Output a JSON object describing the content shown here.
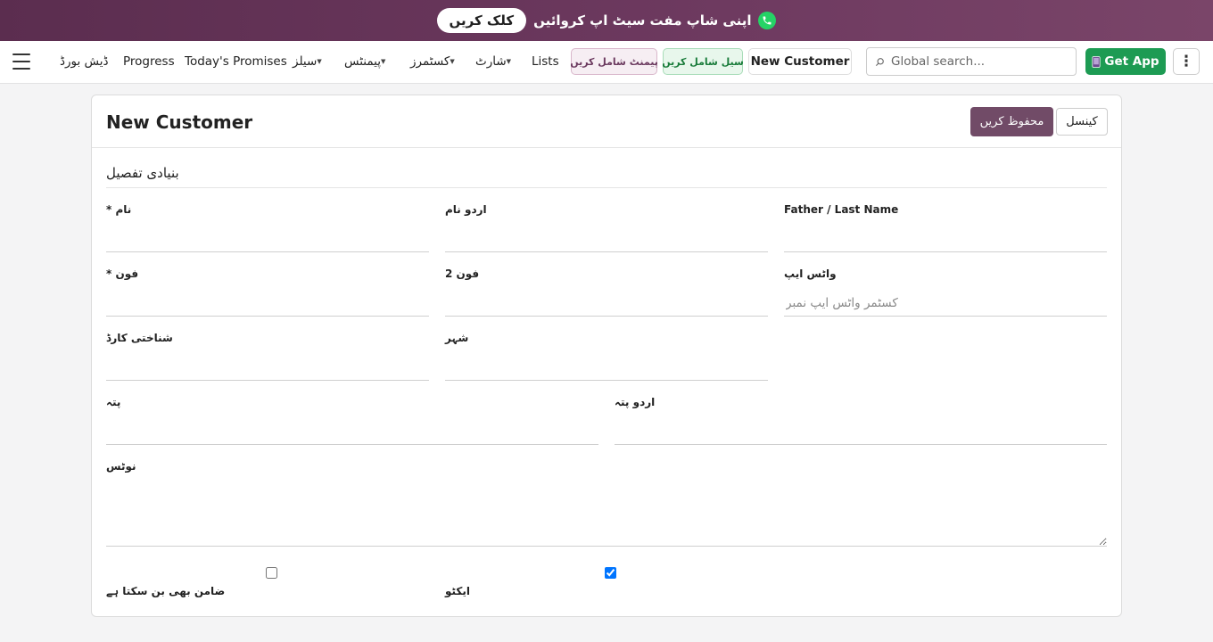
{
  "banner": {
    "text": "اپنی شاپ مفت سیٹ اپ کروائیں",
    "cta": "کلک کریں",
    "icon": "whatsapp-icon"
  },
  "nav": {
    "dashboard": "ڈیش بورڈ",
    "progress": "Progress",
    "todays_promises": "Today's Promises",
    "sales": "سیلز",
    "payments": "پیمنٹس",
    "customers": "کسٹمرز",
    "charts": "شارٹ",
    "lists": "Lists",
    "add_payment": "پیمنٹ شامل کریں",
    "add_sale": "سیل شامل کریں",
    "new_customer": "New Customer",
    "search_placeholder": "Global search...",
    "get_app": "Get App"
  },
  "form": {
    "title": "New Customer",
    "save": "محفوظ کریں",
    "cancel": "کینسل",
    "section": "بنیادی تفصیل",
    "fields": {
      "name": "* نام",
      "urdu_name": "اردو نام",
      "father_last_name": "Father / Last Name",
      "phone": "* فون",
      "phone2": "فون 2",
      "whatsapp": "واٹس ایپ",
      "whatsapp_placeholder": "کسٹمر واٹس ایپ نمبر",
      "id_card": "شناختی کارڈ",
      "city": "شہر",
      "address": "پتہ",
      "urdu_address": "اردو پتہ",
      "notes": "نوٹس",
      "guarantor": "ضامن بھی بن سکتا ہے",
      "active": "ایکٹو"
    },
    "guarantor_checked": false,
    "active_checked": true
  },
  "colors": {
    "brand": "#714b67",
    "banner": "#6e3a60",
    "get_app": "#1d9b53"
  }
}
